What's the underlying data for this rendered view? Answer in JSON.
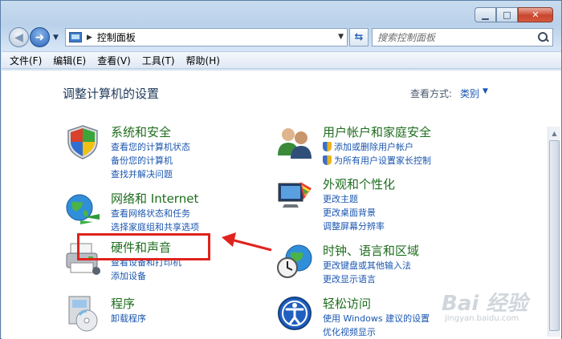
{
  "window": {
    "min_glyph": "▁",
    "max_glyph": "□",
    "close_glyph": "✕"
  },
  "nav": {
    "back_glyph": "◀",
    "forward_glyph": "➜",
    "dropdown_glyph": "▼",
    "refresh_glyph": "⇆"
  },
  "address": {
    "separator": "▶",
    "path": "控制面板",
    "dropdown_glyph": "▼"
  },
  "search": {
    "placeholder": "搜索控制面板"
  },
  "menu": {
    "items": [
      "文件(F)",
      "编辑(E)",
      "查看(V)",
      "工具(T)",
      "帮助(H)"
    ]
  },
  "content": {
    "title": "调整计算机的设置",
    "view_by_label": "查看方式:",
    "view_by_value": "类别",
    "view_by_caret": "▼"
  },
  "categories": {
    "security": {
      "title": "系统和安全",
      "links": [
        "查看您的计算机状态",
        "备份您的计算机",
        "查找并解决问题"
      ]
    },
    "network": {
      "title": "网络和 Internet",
      "links": [
        "查看网络状态和任务",
        "选择家庭组和共享选项"
      ]
    },
    "hardware": {
      "title": "硬件和声音",
      "links": [
        "查看设备和打印机",
        "添加设备"
      ]
    },
    "programs": {
      "title": "程序",
      "links": [
        "卸载程序"
      ]
    },
    "users": {
      "title": "用户帐户和家庭安全",
      "links": [
        "添加或删除用户帐户",
        "为所有用户设置家长控制"
      ]
    },
    "appearance": {
      "title": "外观和个性化",
      "links": [
        "更改主题",
        "更改桌面背景",
        "调整屏幕分辨率"
      ]
    },
    "clock": {
      "title": "时钟、语言和区域",
      "links": [
        "更改键盘或其他输入法",
        "更改显示语言"
      ]
    },
    "ease": {
      "title": "轻松访问",
      "links": [
        "使用 Windows 建议的设置",
        "优化视频显示"
      ]
    }
  },
  "watermark": {
    "text": "Bai 经验",
    "sub": "jingyan.baidu.com"
  },
  "colors": {
    "category_title": "#1d6d1d",
    "link": "#1a56b0",
    "highlight": "#e0231e"
  }
}
